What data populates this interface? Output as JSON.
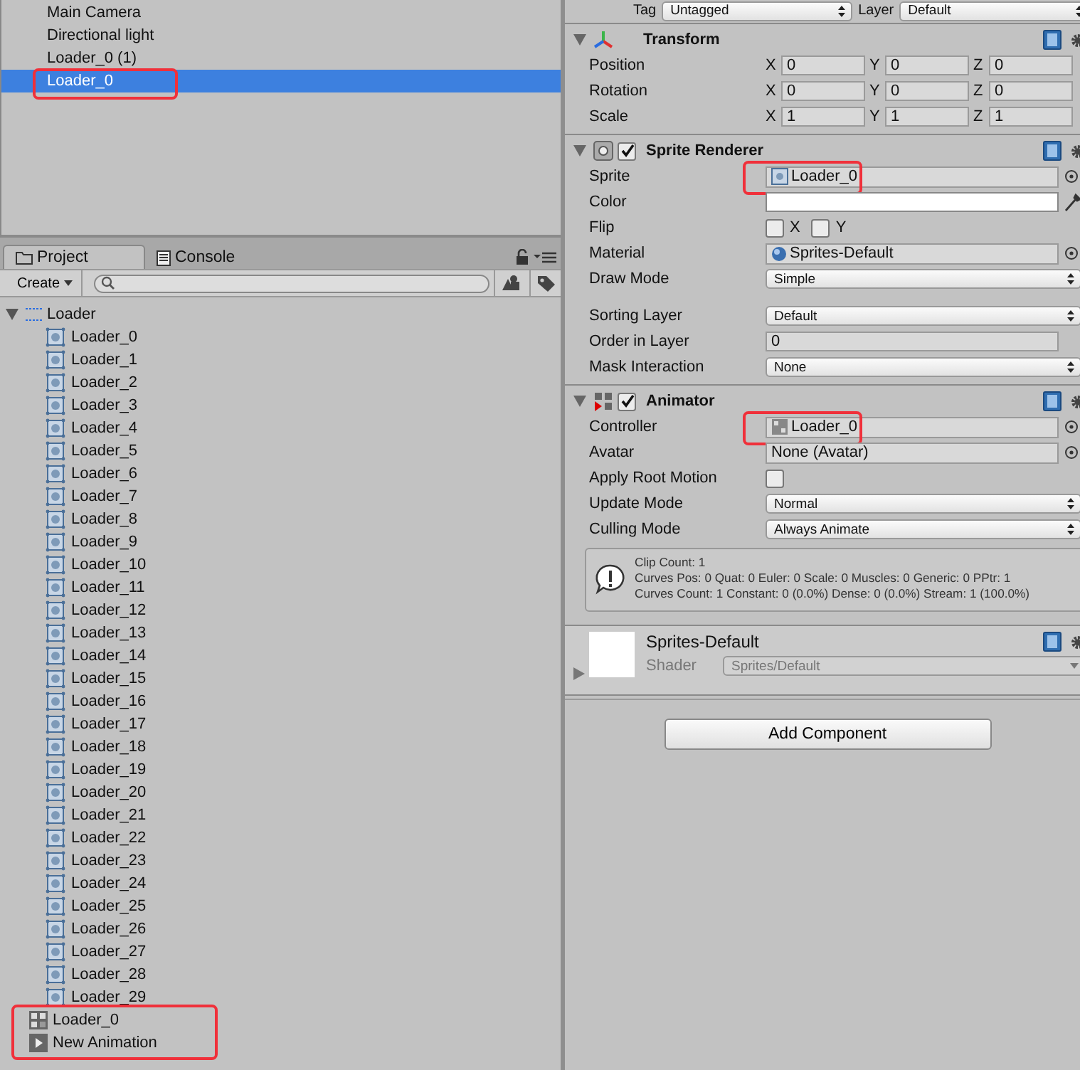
{
  "hierarchy": {
    "items": [
      {
        "label": "Main Camera",
        "selected": false
      },
      {
        "label": "Directional light",
        "selected": false
      },
      {
        "label": "Loader_0 (1)",
        "selected": false
      },
      {
        "label": "Loader_0",
        "selected": true,
        "highlighted": true
      }
    ]
  },
  "project": {
    "tabs": [
      {
        "label": "Project",
        "kind": "folder",
        "selected": true
      },
      {
        "label": "Console",
        "kind": "console",
        "selected": false
      }
    ],
    "create_button": "Create",
    "tree": {
      "label": "Loader",
      "expanded": true,
      "children": [
        {
          "label": "Loader_0"
        },
        {
          "label": "Loader_1"
        },
        {
          "label": "Loader_2"
        },
        {
          "label": "Loader_3"
        },
        {
          "label": "Loader_4"
        },
        {
          "label": "Loader_5"
        },
        {
          "label": "Loader_6"
        },
        {
          "label": "Loader_7"
        },
        {
          "label": "Loader_8"
        },
        {
          "label": "Loader_9"
        },
        {
          "label": "Loader_10"
        },
        {
          "label": "Loader_11"
        },
        {
          "label": "Loader_12"
        },
        {
          "label": "Loader_13"
        },
        {
          "label": "Loader_14"
        },
        {
          "label": "Loader_15"
        },
        {
          "label": "Loader_16"
        },
        {
          "label": "Loader_17"
        },
        {
          "label": "Loader_18"
        },
        {
          "label": "Loader_19"
        },
        {
          "label": "Loader_20"
        },
        {
          "label": "Loader_21"
        },
        {
          "label": "Loader_22"
        },
        {
          "label": "Loader_23"
        },
        {
          "label": "Loader_24"
        },
        {
          "label": "Loader_25"
        },
        {
          "label": "Loader_26"
        },
        {
          "label": "Loader_27"
        },
        {
          "label": "Loader_28"
        },
        {
          "label": "Loader_29"
        }
      ]
    },
    "assets": [
      {
        "label": "Loader_0",
        "kind": "controller"
      },
      {
        "label": "New Animation",
        "kind": "animation"
      }
    ],
    "assets_highlighted": true
  },
  "inspector": {
    "tag_row": {
      "tag_label": "Tag",
      "tag": "Untagged",
      "layer_label": "Layer",
      "layer": "Default"
    },
    "components": [
      {
        "kind": "transform",
        "title": "Transform",
        "rows": [
          {
            "label": "Position",
            "values": [
              {
                "axis": "X",
                "value": "0"
              },
              {
                "axis": "Y",
                "value": "0"
              },
              {
                "axis": "Z",
                "value": "0"
              }
            ]
          },
          {
            "label": "Rotation",
            "values": [
              {
                "axis": "X",
                "value": "0"
              },
              {
                "axis": "Y",
                "value": "0"
              },
              {
                "axis": "Z",
                "value": "0"
              }
            ]
          },
          {
            "label": "Scale",
            "values": [
              {
                "axis": "X",
                "value": "1"
              },
              {
                "axis": "Y",
                "value": "1"
              },
              {
                "axis": "Z",
                "value": "1"
              }
            ]
          }
        ]
      },
      {
        "kind": "sprite",
        "title": "Sprite Renderer",
        "enabled": true,
        "rows": [
          {
            "kind": "sprite_ref",
            "label": "Sprite",
            "value": "Loader_0",
            "highlighted": true
          },
          {
            "kind": "color",
            "label": "Color",
            "color": "#ffffff"
          },
          {
            "kind": "flip",
            "label": "Flip",
            "options": [
              {
                "label": "X",
                "checked": false
              },
              {
                "label": "Y",
                "checked": false
              }
            ]
          },
          {
            "kind": "material_ref",
            "label": "Material",
            "value": "Sprites-Default"
          },
          {
            "kind": "popup",
            "label": "Draw Mode",
            "value": "Simple"
          },
          {
            "kind": "gap"
          },
          {
            "kind": "popup",
            "label": "Sorting Layer",
            "value": "Default"
          },
          {
            "kind": "number",
            "label": "Order in Layer",
            "value": "0"
          },
          {
            "kind": "popup",
            "label": "Mask Interaction",
            "value": "None"
          }
        ]
      },
      {
        "kind": "animator",
        "title": "Animator",
        "enabled": true,
        "rows": [
          {
            "kind": "controller_ref",
            "label": "Controller",
            "value": "Loader_0",
            "highlighted": true
          },
          {
            "kind": "plain_ref",
            "label": "Avatar",
            "value": "None (Avatar)"
          },
          {
            "kind": "checkbox",
            "label": "Apply Root Motion",
            "checked": false
          },
          {
            "kind": "popup",
            "label": "Update Mode",
            "value": "Normal"
          },
          {
            "kind": "popup",
            "label": "Culling Mode",
            "value": "Always Animate"
          }
        ],
        "info": [
          "Clip Count: 1",
          "Curves Pos: 0 Quat: 0 Euler: 0 Scale: 0 Muscles: 0 Generic: 0 PPtr: 1",
          "Curves Count: 1 Constant: 0 (0.0%) Dense: 0 (0.0%) Stream: 1 (100.0%)"
        ]
      }
    ],
    "material": {
      "name": "Sprites-Default",
      "shader_label": "Shader",
      "shader": "Sprites/Default"
    },
    "add_component": "Add Component"
  }
}
